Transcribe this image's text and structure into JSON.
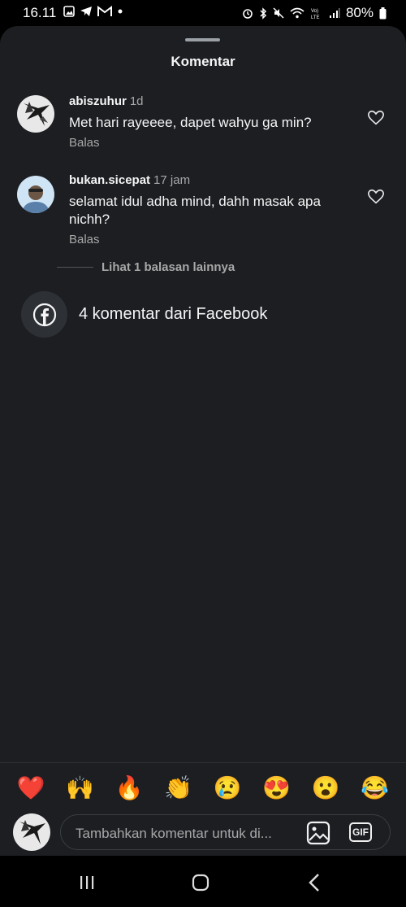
{
  "status_bar": {
    "time": "16.11",
    "left_icons": [
      "gallery-icon",
      "telegram-icon",
      "gmail-icon",
      "dot-icon"
    ],
    "right_icons": [
      "alarm-icon",
      "bluetooth-icon",
      "mute-icon",
      "wifi-icon",
      "volte-icon",
      "signal-icon"
    ],
    "battery": "80%"
  },
  "sheet": {
    "title": "Komentar"
  },
  "comments": [
    {
      "username": "abiszuhur",
      "time": "1d",
      "text": "Met hari rayeeee, dapet wahyu ga min?",
      "reply_label": "Balas"
    },
    {
      "username": "bukan.sicepat",
      "time": "17 jam",
      "text": "selamat idul adha mind, dahh masak apa nichh?",
      "reply_label": "Balas"
    }
  ],
  "more_replies": "Lihat 1 balasan lainnya",
  "facebook_row": {
    "text": "4 komentar dari Facebook"
  },
  "emoji_reactions": [
    "❤️",
    "🙌",
    "🔥",
    "👏",
    "😢",
    "😍",
    "😮",
    "😂"
  ],
  "composer": {
    "placeholder": "Tambahkan komentar untuk di...",
    "gif_label": "GIF"
  },
  "colors": {
    "sheet_bg": "#1c1e22",
    "secondary_text": "#a8a8a8"
  }
}
